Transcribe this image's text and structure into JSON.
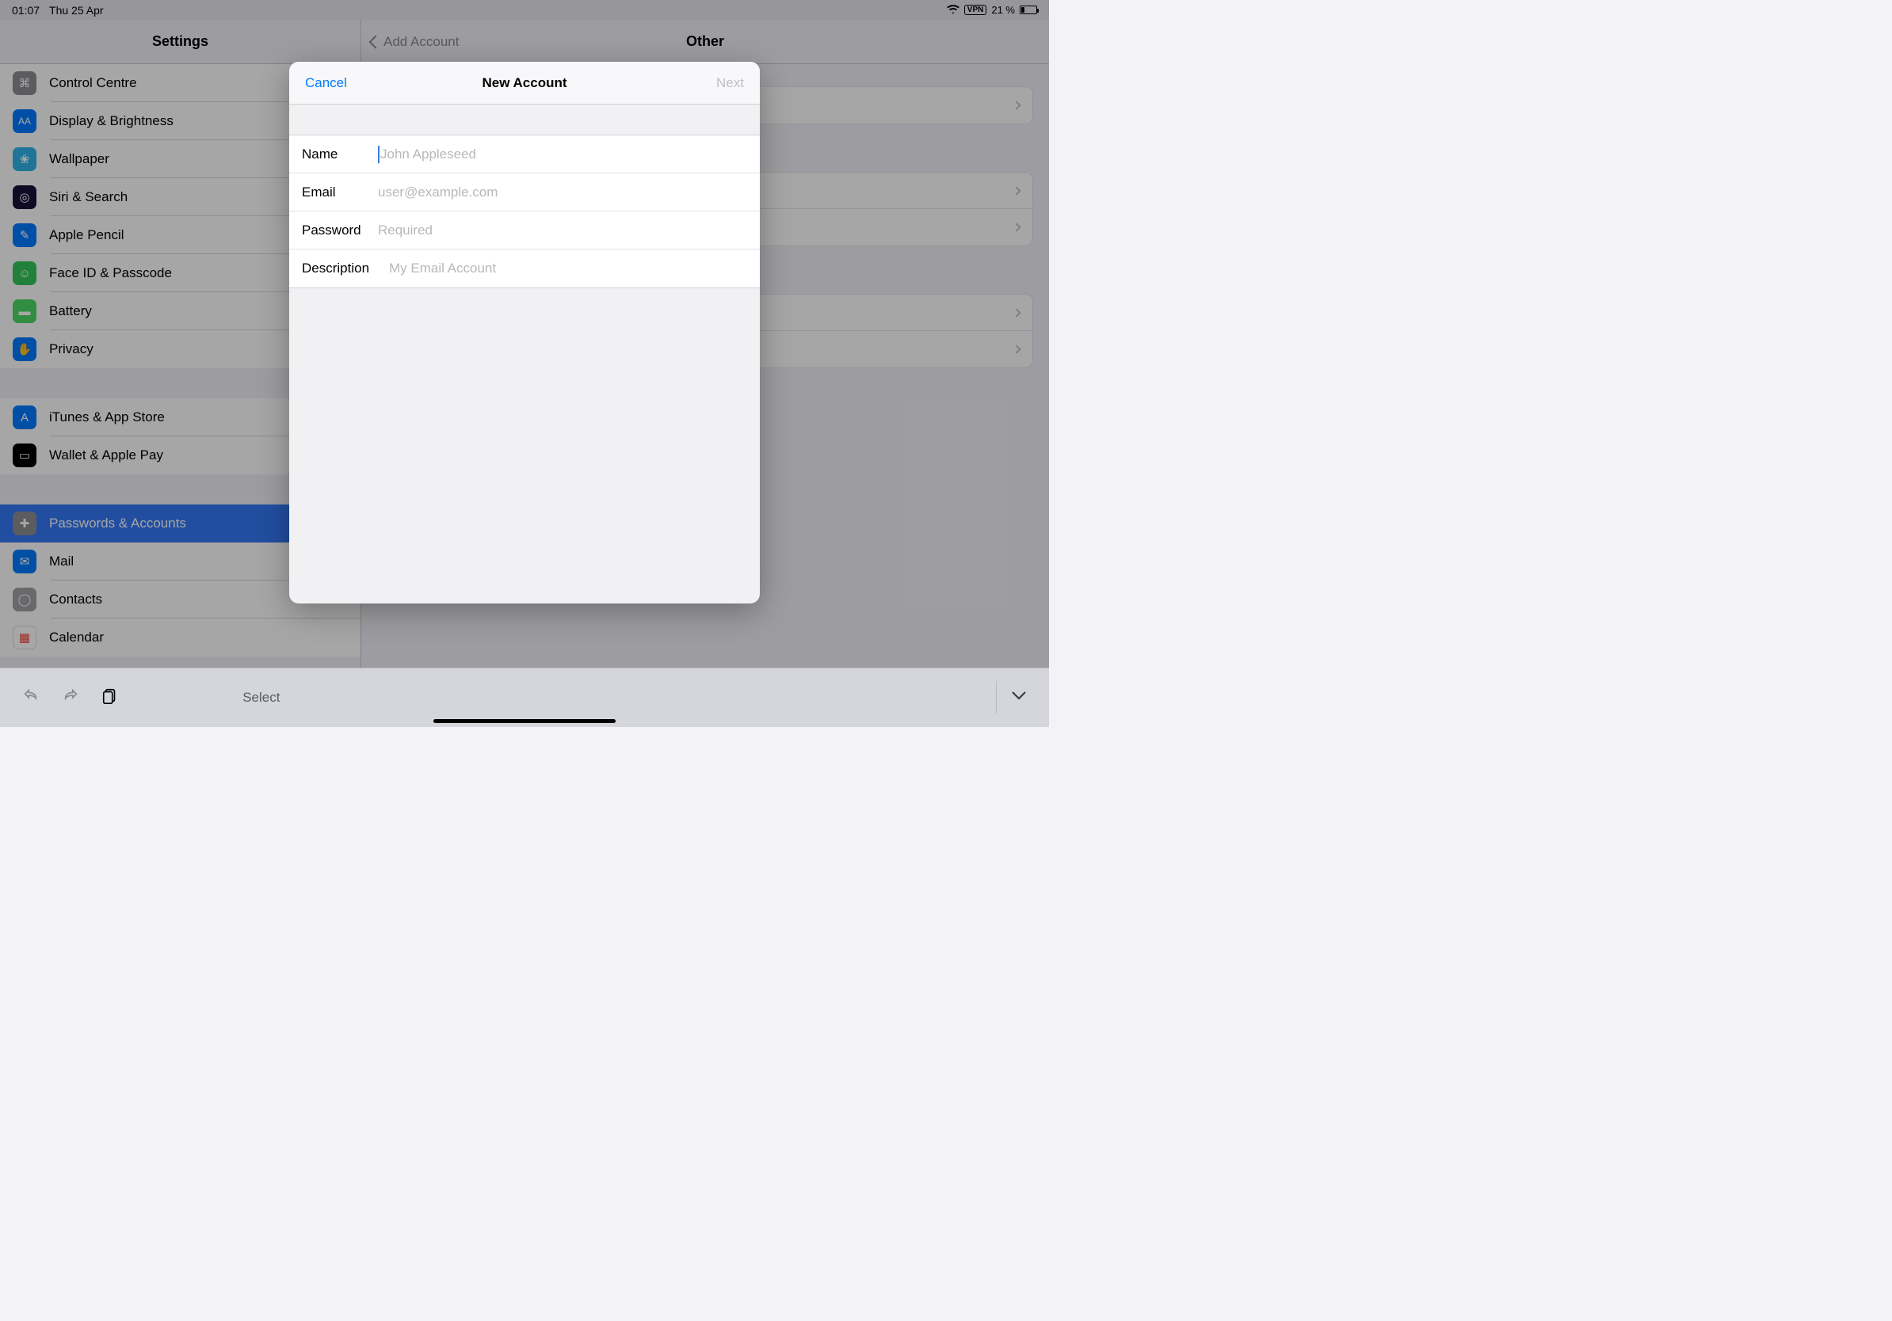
{
  "status": {
    "time": "01:07",
    "date": "Thu 25 Apr",
    "vpn": "VPN",
    "battery_text": "21 %"
  },
  "sidebar": {
    "title": "Settings",
    "groups": [
      [
        {
          "label": "Control Centre",
          "icon": "control-centre",
          "bg": "bg-grey",
          "name": "sidebar-item-control-centre"
        },
        {
          "label": "Display & Brightness",
          "icon": "display",
          "bg": "bg-blue",
          "name": "sidebar-item-display-brightness"
        },
        {
          "label": "Wallpaper",
          "icon": "wallpaper",
          "bg": "bg-cyan",
          "name": "sidebar-item-wallpaper"
        },
        {
          "label": "Siri & Search",
          "icon": "siri",
          "bg": "bg-purple",
          "name": "sidebar-item-siri-search"
        },
        {
          "label": "Apple Pencil",
          "icon": "pencil",
          "bg": "bg-blue",
          "name": "sidebar-item-apple-pencil"
        },
        {
          "label": "Face ID & Passcode",
          "icon": "faceid",
          "bg": "bg-green",
          "name": "sidebar-item-faceid-passcode"
        },
        {
          "label": "Battery",
          "icon": "battery",
          "bg": "bg-green2",
          "name": "sidebar-item-battery"
        },
        {
          "label": "Privacy",
          "icon": "privacy",
          "bg": "bg-blue",
          "name": "sidebar-item-privacy"
        }
      ],
      [
        {
          "label": "iTunes & App Store",
          "icon": "appstore",
          "bg": "bg-blue",
          "name": "sidebar-item-itunes-appstore"
        },
        {
          "label": "Wallet & Apple Pay",
          "icon": "wallet",
          "bg": "bg-wallet",
          "name": "sidebar-item-wallet-applepay"
        }
      ],
      [
        {
          "label": "Passwords & Accounts",
          "icon": "key",
          "bg": "bg-key",
          "name": "sidebar-item-passwords-accounts",
          "selected": true
        },
        {
          "label": "Mail",
          "icon": "mail",
          "bg": "bg-blue",
          "name": "sidebar-item-mail"
        },
        {
          "label": "Contacts",
          "icon": "contacts",
          "bg": "bg-contacts",
          "name": "sidebar-item-contacts"
        },
        {
          "label": "Calendar",
          "icon": "calendar",
          "bg": "bg-calendar",
          "name": "sidebar-item-calendar"
        }
      ]
    ]
  },
  "detail": {
    "back_label": "Add Account",
    "title": "Other"
  },
  "modal": {
    "cancel": "Cancel",
    "title": "New Account",
    "next": "Next",
    "fields": {
      "name": {
        "label": "Name",
        "placeholder": "John Appleseed",
        "value": ""
      },
      "email": {
        "label": "Email",
        "placeholder": "user@example.com",
        "value": ""
      },
      "password": {
        "label": "Password",
        "placeholder": "Required",
        "value": ""
      },
      "description": {
        "label": "Description",
        "placeholder": "My Email Account",
        "value": ""
      }
    }
  },
  "keyboard_toolbar": {
    "select": "Select"
  }
}
